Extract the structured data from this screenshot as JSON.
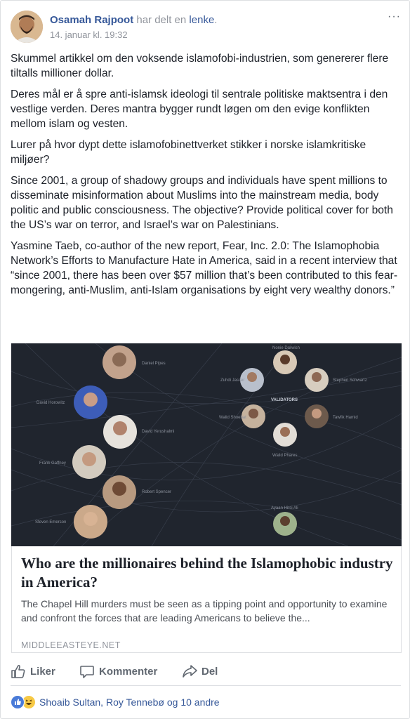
{
  "post": {
    "author_name": "Osamah Rajpoot",
    "shared_text": "har delt en",
    "shared_link": "lenke",
    "period": ".",
    "timestamp": "14. januar kl. 19:32",
    "more_label": "···",
    "paragraphs": [
      "Skummel artikkel om den voksende islamofobi-industrien, som genererer flere tiltalls millioner dollar.",
      "Deres mål er å spre anti-islamsk ideologi til sentrale politiske maktsentra i den vestlige verden. Deres mantra bygger rundt løgen om den evige konflikten mellom islam og vesten.",
      "Lurer på hvor dypt dette islamofobinettverket stikker i norske islamkritiske miljøer?",
      "Since 2001, a group of shadowy groups and individuals have spent millions to disseminate misinformation about Muslims into the mainstream media, body politic and public consciousness. The objective? Provide political cover for both the US’s war on terror, and Israel’s war on Palestinians.",
      "Yasmine Taeb, co-author of the new report, Fear, Inc. 2.0: The Islamophobia Network’s Efforts to Manufacture Hate in America, said in a recent interview that “since 2001, there has been over $57 million that’s been contributed to this fear-mongering, anti-Muslim, anti-Islam organisations by eight very wealthy donors.”"
    ]
  },
  "link_preview": {
    "title": "Who are the millionaires behind the Islamophobic industry in America?",
    "description": "The Chapel Hill murders must be seen as a tipping point and opportunity to examine and confront the forces that are leading Americans to believe the...",
    "domain": "MIDDLEEASTEYE.NET",
    "image_labels": {
      "left": [
        "Daniel Pipes",
        "David Horowitz",
        "David Yerushalmi",
        "Frank Gaffney",
        "Robert Spencer",
        "Steven Emerson"
      ],
      "right": [
        "Nonie Darwish",
        "Zuhdi Jasser",
        "Stephen Schwartz",
        "VALIDATORS",
        "Walid Shoebat",
        "Tawfik Hamid",
        "Walid Phares",
        "Ayaan Hirsi Ali"
      ]
    }
  },
  "actions": {
    "like": "Liker",
    "comment": "Kommenter",
    "share": "Del"
  },
  "reactions": {
    "summary": "Shoaib Sultan, Roy Tennebø og 10 andre"
  },
  "colors": {
    "link_blue": "#365899",
    "meta_gray": "#90949c",
    "action_gray": "#606770",
    "image_bg": "#20252e"
  }
}
